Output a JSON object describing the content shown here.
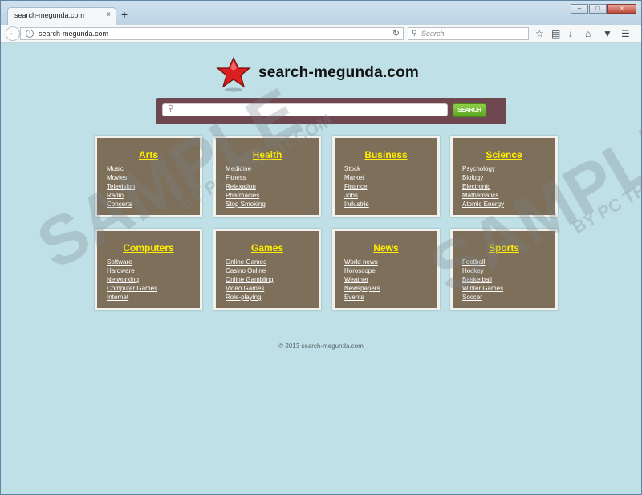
{
  "browser": {
    "tab_title": "search-megunda.com",
    "tab_close": "×",
    "new_tab": "+",
    "url": "search-megunda.com",
    "search_placeholder": "Search",
    "window_controls": {
      "minimize": "–",
      "maximize": "□",
      "close": "×"
    },
    "icons": [
      "back-icon",
      "info-icon",
      "reload-icon",
      "search-icon",
      "star-icon",
      "reading-list-icon",
      "download-icon",
      "home-icon",
      "pocket-icon",
      "menu-icon"
    ]
  },
  "page": {
    "logo_text": "search-megunda.com",
    "search_button": "SEARCH",
    "categories": [
      {
        "title": "Arts",
        "links": [
          "Music",
          "Movies",
          "Television",
          "Radio",
          "Concerts"
        ]
      },
      {
        "title": "Health",
        "links": [
          "Medicine",
          "Fitness",
          "Relaxation",
          "Pharmacies",
          "Stop Smoking"
        ]
      },
      {
        "title": "Business",
        "links": [
          "Stock",
          "Market",
          "Finance",
          "Jobs",
          "Industrie"
        ]
      },
      {
        "title": "Science",
        "links": [
          "Psychology",
          "Biology",
          "Electronic",
          "Mathematics",
          "Atomic Energy"
        ]
      },
      {
        "title": "Computers",
        "links": [
          "Software",
          "Hardware",
          "Networking",
          "Computer Games",
          "Internet"
        ]
      },
      {
        "title": "Games",
        "links": [
          "Online Games",
          "Casino Online",
          "Online Gambling",
          "Video Games",
          "Role-playing"
        ]
      },
      {
        "title": "News",
        "links": [
          "World news",
          "Horoscope",
          "Weather",
          "Newspapers",
          "Events"
        ]
      },
      {
        "title": "Sports",
        "links": [
          "Football",
          "Hockey",
          "Basketball",
          "Winter Games",
          "Soccer"
        ]
      }
    ],
    "footer": "© 2013 search-megunda.com"
  },
  "watermark": {
    "main": "SAMPLE",
    "sub": "BY PC THREAT.COM"
  },
  "colors": {
    "page_bg": "#bfe0e6",
    "card_bg": "#7d6f5a",
    "card_title": "#ffee00",
    "search_panel": "#6f4751",
    "search_button": "#6cb52a"
  }
}
